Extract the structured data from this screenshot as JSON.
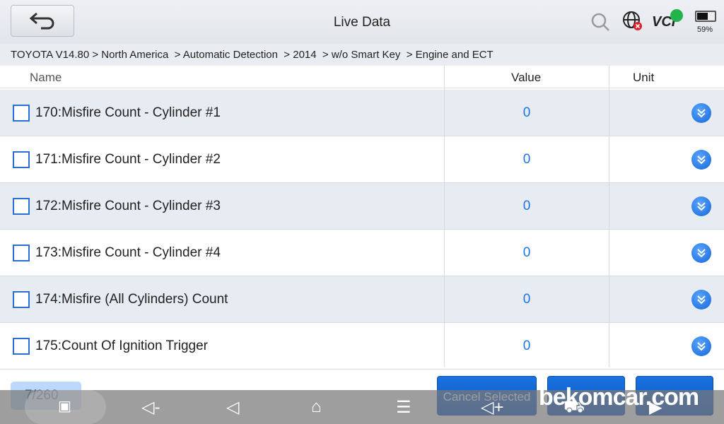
{
  "header": {
    "title": "Live Data",
    "icons": [
      "back-arrow-icon",
      "search-icon",
      "network-globe-error-icon",
      "vci-wifi-icon",
      "battery-icon"
    ],
    "battery": "59%"
  },
  "breadcrumb": "TOYOTA V14.80 > North America  > Automatic Detection  > 2014  > w/o Smart Key  > Engine and ECT",
  "columns": {
    "name": "Name",
    "value": "Value",
    "unit": "Unit"
  },
  "rows": [
    {
      "name": "170:Misfire Count - Cylinder #1",
      "value": "0",
      "unit": ""
    },
    {
      "name": "171:Misfire Count - Cylinder #2",
      "value": "0",
      "unit": ""
    },
    {
      "name": "172:Misfire Count - Cylinder #3",
      "value": "0",
      "unit": ""
    },
    {
      "name": "173:Misfire Count - Cylinder #4",
      "value": "0",
      "unit": ""
    },
    {
      "name": "174:Misfire (All Cylinders) Count",
      "value": "0",
      "unit": ""
    },
    {
      "name": "175:Count Of Ignition Trigger",
      "value": "0",
      "unit": ""
    }
  ],
  "footer": {
    "count": "7/260",
    "buttons": [
      "Cancel Selected"
    ]
  },
  "watermark": "bekomcar.com",
  "colors": {
    "accent": "#1a73e8",
    "row_alt": "#e7ebf2"
  }
}
